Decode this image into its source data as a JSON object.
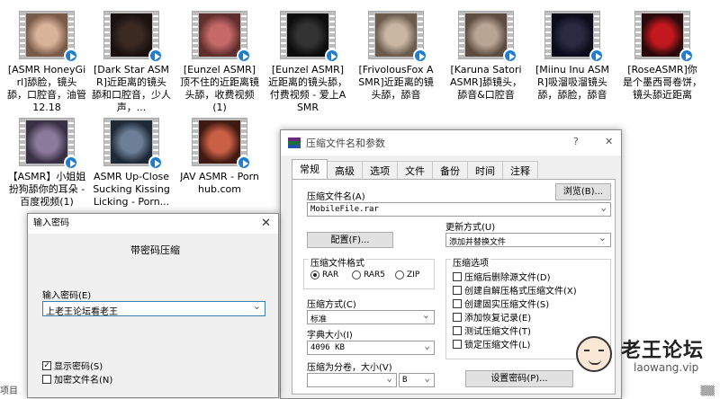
{
  "files": [
    {
      "name": "[ASMR HoneyGirl]舔脸，镜头舔，口腔音，油管12.18",
      "color": "#d9b29a",
      "bg": "#7a5a48"
    },
    {
      "name": "[Dark Star ASMR]近距离的镜头舔和口腔音，少人声，...",
      "color": "#3a2a22",
      "bg": "#1b1210"
    },
    {
      "name": "[Eunzel ASMR]顶不住的近距离镜头舔，收费视频(1)",
      "color": "#c46868",
      "bg": "#5e2f2d"
    },
    {
      "name": "[Eunzel ASMR]近距离的镜头舔，付费视频 - 爱上ASMR",
      "color": "#333333",
      "bg": "#0d0d0d"
    },
    {
      "name": "[FrivolousFox ASMR]近距离的镜头舔，舔音",
      "color": "#c9b7a4",
      "bg": "#6a5b4d"
    },
    {
      "name": "[Karuna Satori ASMR]舔镜头，舔音&口腔音",
      "color": "#b9a594",
      "bg": "#5d4c40"
    },
    {
      "name": "[Miinu Inu ASMR]吸溜吸溜镜头舔，舔脸，舔音",
      "color": "#2a2a40",
      "bg": "#0b0b1a"
    },
    {
      "name": "[RoseASMR]你是个墨西哥卷饼，镜头舔近距离",
      "color": "#c2181e",
      "bg": "#2a0a0a"
    },
    {
      "name": "【ASMR】小姐姐扮狗舔你的耳朵 - 百度视频(1)",
      "color": "#8c7a9a",
      "bg": "#3a3046"
    },
    {
      "name": "ASMR Up-Close Sucking Kissing Licking - Porn...",
      "color": "#6c7f96",
      "bg": "#1f2a38"
    },
    {
      "name": "JAV ASMR - Pornhub.com",
      "color": "#c95f45",
      "bg": "#3e1a12"
    }
  ],
  "status": {
    "left": "项目",
    "right": "▒▒"
  },
  "archive_dialog": {
    "title": "压缩文件名和参数",
    "help": "?",
    "close": "✕",
    "tabs": [
      "常规",
      "高级",
      "选项",
      "文件",
      "备份",
      "时间",
      "注释"
    ],
    "archive_name_label": "压缩文件名(A)",
    "browse_button": "浏览(B)...",
    "archive_name_value": "MobileFile.rar",
    "update_mode_label": "更新方式(U)",
    "update_mode_value": "添加并替换文件",
    "profile_button": "配置(F)...",
    "format_label": "压缩文件格式",
    "formats": [
      "RAR",
      "RAR5",
      "ZIP"
    ],
    "selected_format": "RAR",
    "options_label": "压缩选项",
    "options": [
      "压缩后删除源文件(D)",
      "创建自解压格式压缩文件(X)",
      "创建固实压缩文件(S)",
      "添加恢复记录(E)",
      "测试压缩文件(T)",
      "锁定压缩文件(L)"
    ],
    "method_label": "压缩方式(C)",
    "method_value": "标准",
    "dict_label": "字典大小(I)",
    "dict_value": "4096 KB",
    "split_label": "压缩为分卷，大小(V)",
    "split_unit": "B",
    "set_password_button": "设置密码(P)..."
  },
  "password_dialog": {
    "title": "输入密码",
    "close": "✕",
    "heading": "带密码压缩",
    "enter_label": "输入密码(E)",
    "password_value": "上老王论坛看老王",
    "show_password_label": "显示密码(S)",
    "show_password_checked": true,
    "encrypt_names_label": "加密文件名(N)",
    "encrypt_names_checked": false
  },
  "watermark": {
    "title": "老王论坛",
    "url": "laowang.vip"
  }
}
